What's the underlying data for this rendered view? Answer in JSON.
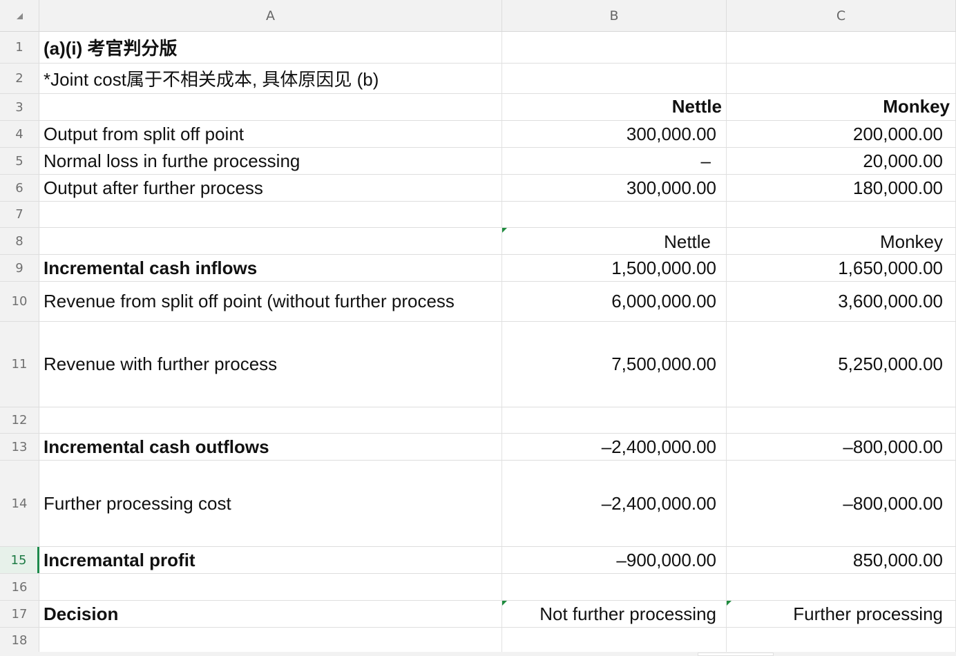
{
  "columns": {
    "a": "A",
    "b": "B",
    "c": "C"
  },
  "rows": [
    {
      "num": "1",
      "a": "(a)(i) 考官判分版",
      "b": "",
      "c": ""
    },
    {
      "num": "2",
      "a": "*Joint cost属于不相关成本, 具体原因见 (b)",
      "b": "",
      "c": ""
    },
    {
      "num": "3",
      "a": "",
      "b": "Nettle",
      "c": "Monkey"
    },
    {
      "num": "4",
      "a": "Output from split off point",
      "b": "300,000.00",
      "c": "200,000.00"
    },
    {
      "num": "5",
      "a": "Normal loss in furthe processing",
      "b": "–",
      "c": "20,000.00"
    },
    {
      "num": "6",
      "a": "Output after further process",
      "b": "300,000.00",
      "c": "180,000.00"
    },
    {
      "num": "7",
      "a": "",
      "b": "",
      "c": ""
    },
    {
      "num": "8",
      "a": "",
      "b": "Nettle",
      "c": "Monkey"
    },
    {
      "num": "9",
      "a": "Incremental cash inflows",
      "b": "1,500,000.00",
      "c": "1,650,000.00"
    },
    {
      "num": "10",
      "a": "Revenue from split off point (without further process",
      "b": "6,000,000.00",
      "c": "3,600,000.00"
    },
    {
      "num": "11",
      "a": "Revenue with further process",
      "b": "7,500,000.00",
      "c": "5,250,000.00"
    },
    {
      "num": "12",
      "a": "",
      "b": "",
      "c": ""
    },
    {
      "num": "13",
      "a": "Incremental cash outflows",
      "b": "–2,400,000.00",
      "c": "–800,000.00"
    },
    {
      "num": "14",
      "a": "Further processing cost",
      "b": "–2,400,000.00",
      "c": "–800,000.00"
    },
    {
      "num": "15",
      "a": "Incremantal profit",
      "b": "–900,000.00",
      "c": "850,000.00"
    },
    {
      "num": "16",
      "a": "",
      "b": "",
      "c": ""
    },
    {
      "num": "17",
      "a": "Decision",
      "b": "Not further processing",
      "c": "Further processing"
    },
    {
      "num": "18",
      "a": "",
      "b": "",
      "c": ""
    }
  ],
  "active_row": "15",
  "colors": {
    "header_bg": "#f2f2f2",
    "gridline": "#dedede",
    "active_green": "#1e8a4c",
    "comment_marker": "#1f8b3e"
  }
}
